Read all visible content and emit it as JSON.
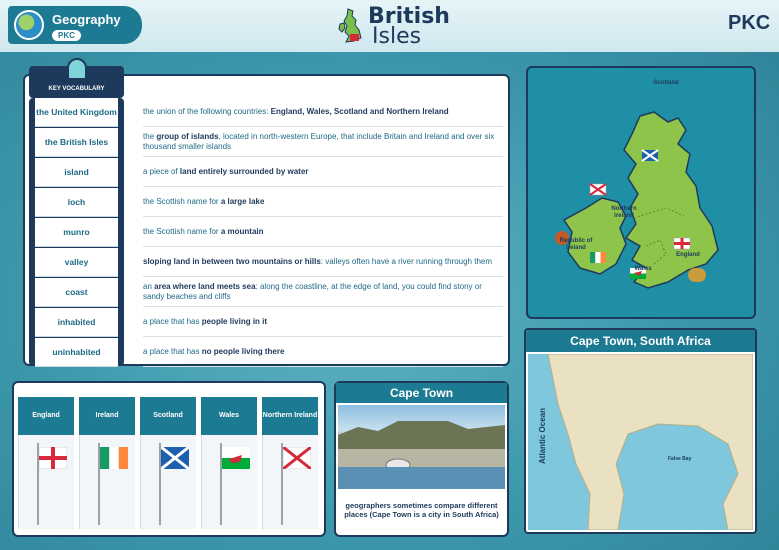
{
  "header": {
    "subject": "Geography",
    "subject_tag": "PKC",
    "title_line1": "British",
    "title_line2": "Isles",
    "logo": "PKC"
  },
  "vocab": {
    "heading": "KEY VOCABULARY",
    "rows": [
      {
        "term": "the United Kingdom",
        "def_plain": "the union of the following countries: ",
        "def_bold": "England, Wales, Scotland and Northern Ireland",
        "def_tail": ""
      },
      {
        "term": "the British Isles",
        "def_plain": "the ",
        "def_bold": "group of islands",
        "def_tail": ", located in north-western Europe, that include Britain and Ireland and over six thousand smaller islands"
      },
      {
        "term": "island",
        "def_plain": "a piece of ",
        "def_bold": "land entirely surrounded by water",
        "def_tail": ""
      },
      {
        "term": "loch",
        "def_plain": "the Scottish name for ",
        "def_bold": "a large lake",
        "def_tail": ""
      },
      {
        "term": "munro",
        "def_plain": "the Scottish name for ",
        "def_bold": "a mountain",
        "def_tail": ""
      },
      {
        "term": "valley",
        "def_plain": "",
        "def_bold": "sloping land in between two mountains or hills",
        "def_tail": ": valleys often have a river running through them"
      },
      {
        "term": "coast",
        "def_plain": "an ",
        "def_bold": "area where land meets sea",
        "def_tail": ": along the coastline, at the edge of land, you could find stony or sandy beaches and cliffs"
      },
      {
        "term": "inhabited",
        "def_plain": "a place that has ",
        "def_bold": "people living in it",
        "def_tail": ""
      },
      {
        "term": "uninhabited",
        "def_plain": "a place that has ",
        "def_bold": "no people living there",
        "def_tail": ""
      }
    ]
  },
  "map": {
    "labels": {
      "scotland": "Scotland",
      "ni": "Northern Ireland",
      "roi": "Republic of Ireland",
      "wales": "Wales",
      "england": "England"
    }
  },
  "flags": {
    "countries": [
      "England",
      "Ireland",
      "Scotland",
      "Wales",
      "Northern Ireland"
    ]
  },
  "cape_town_photo": {
    "title": "Cape Town",
    "caption": "geographers sometimes compare different places (Cape Town is a city in South Africa)"
  },
  "cape_town_map": {
    "title": "Cape Town, South Africa",
    "ocean_label": "Atlantic Ocean",
    "bay_label": "False Bay"
  },
  "colors": {
    "navy": "#1d3a5c",
    "teal": "#1d7a93",
    "land_green": "#8fc44a"
  }
}
